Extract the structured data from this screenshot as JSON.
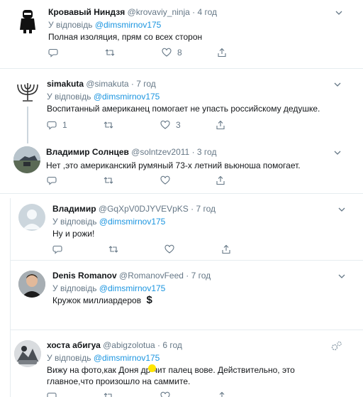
{
  "tweets": [
    {
      "name": "Кровавый Ниндзя",
      "handle": "@krovaviy_ninja",
      "dot": "·",
      "time": "4 год",
      "reply_prefix": "У відповідь",
      "reply_to": "@dimsmirnov175",
      "text": "Полная изоляция, прям со всех сторон",
      "likes": "8"
    },
    {
      "name": "simakuta",
      "handle": "@simakuta",
      "dot": "·",
      "time": "7 год",
      "reply_prefix": "У відповідь",
      "reply_to": "@dimsmirnov175",
      "text": "Воспитанный американец помогает не упасть российскому дедушке.",
      "replies": "1",
      "likes": "3"
    },
    {
      "name": "Владимир Солнцев",
      "handle": "@solntzev2011",
      "dot": "·",
      "time": "3 год",
      "text": "Нет ,это американский румяный 73-х летний вьюноша помогает."
    },
    {
      "name": "Владимир",
      "handle": "@GqXpV0DJYVEVpKS",
      "dot": "·",
      "time": "7 год",
      "reply_prefix": "У відповідь",
      "reply_to": "@dimsmirnov175",
      "text": "Ну и рожи!"
    },
    {
      "name": "Denis Romanov",
      "handle": "@RomanovFeed",
      "dot": "·",
      "time": "7 год",
      "reply_prefix": "У відповідь",
      "reply_to": "@dimsmirnov175",
      "text": "Кружок миллиардеров",
      "emoji": "$"
    },
    {
      "name": "хоста абигуа",
      "handle": "@abigzolotua",
      "dot": "·",
      "time": "6 год",
      "reply_prefix": "У відповідь",
      "reply_to": "@dimsmirnov175",
      "text": "Вижу на фото,как Доня др   чит палец вове. Действительно, это главное,что произошло на саммите."
    }
  ],
  "colors": {
    "link": "#1b95e0",
    "muted": "#657786",
    "border": "#e6ecf0",
    "thread": "#ccd6dd"
  }
}
